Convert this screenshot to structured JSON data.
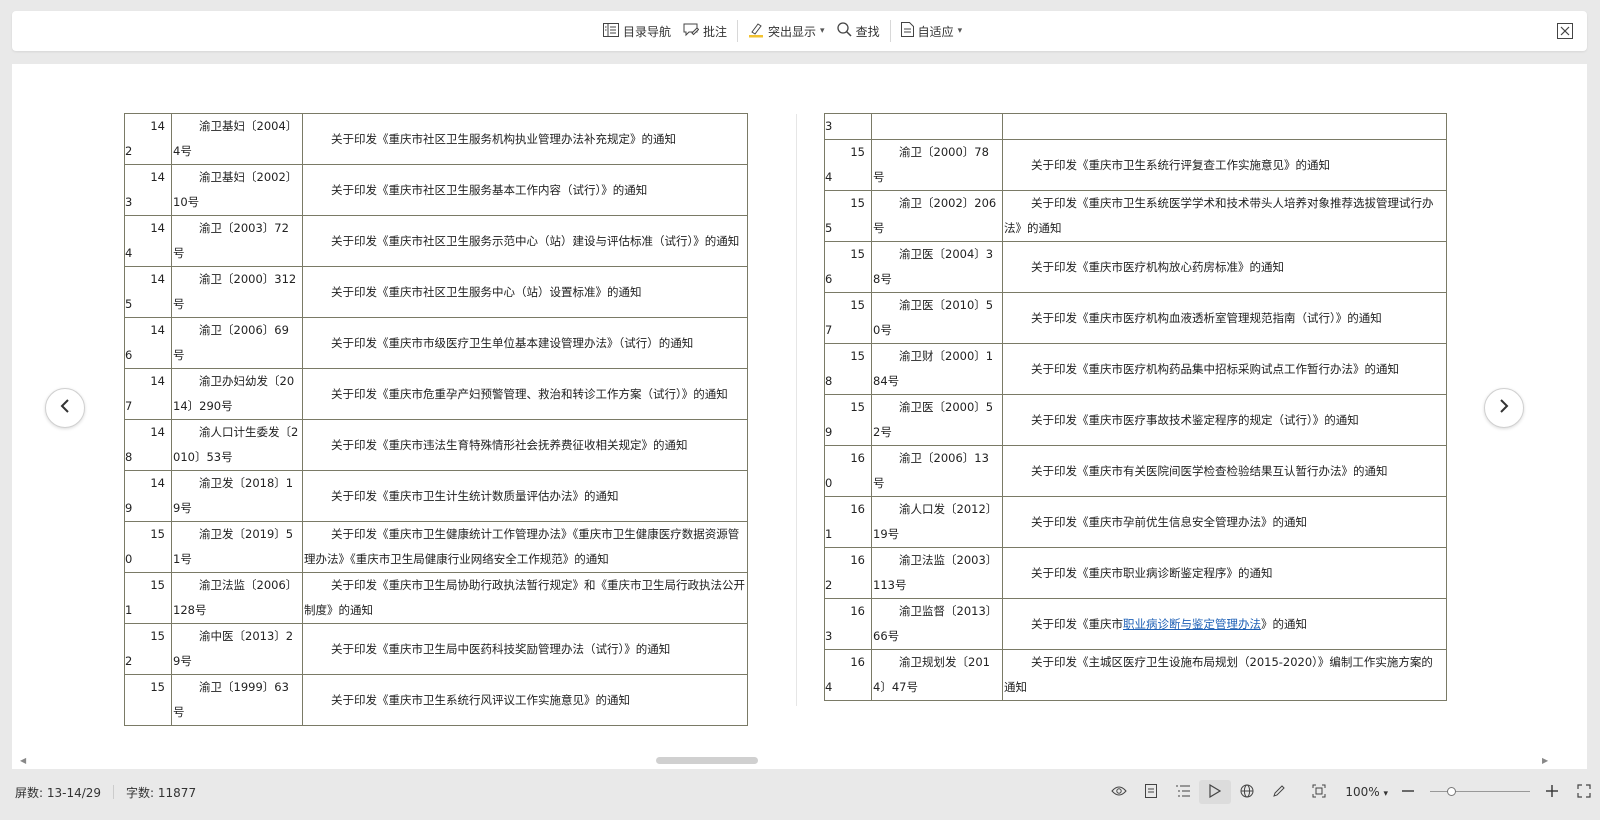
{
  "toolbar": {
    "toc_label": "目录导航",
    "annotate_label": "批注",
    "highlight_label": "突出显示",
    "find_label": "查找",
    "fit_label": "自适应"
  },
  "left_rows": [
    {
      "n1": "14",
      "n2": "2",
      "code": "渝卫基妇〔2004〕4号",
      "title": "关于印发《重庆市社区卫生服务机构执业管理办法补充规定》的通知"
    },
    {
      "n1": "14",
      "n2": "3",
      "code": "渝卫基妇〔2002〕10号",
      "title": "关于印发《重庆市社区卫生服务基本工作内容（试行）》的通知"
    },
    {
      "n1": "14",
      "n2": "4",
      "code": "渝卫〔2003〕72号",
      "title": "关于印发《重庆市社区卫生服务示范中心（站）建设与评估标准（试行）》的通知"
    },
    {
      "n1": "14",
      "n2": "5",
      "code": "渝卫〔2000〕312号",
      "title": "关于印发《重庆市社区卫生服务中心（站）设置标准》的通知"
    },
    {
      "n1": "14",
      "n2": "6",
      "code": "渝卫〔2006〕69号",
      "title": "关于印发《重庆市市级医疗卫生单位基本建设管理办法》（试行）的通知"
    },
    {
      "n1": "14",
      "n2": "7",
      "code": "渝卫办妇幼发〔2014〕290号",
      "title": "关于印发《重庆市危重孕产妇预警管理、救治和转诊工作方案（试行）》的通知"
    },
    {
      "n1": "14",
      "n2": "8",
      "code": "渝人口计生委发〔2010〕53号",
      "title": "关于印发《重庆市违法生育特殊情形社会抚养费征收相关规定》的通知"
    },
    {
      "n1": "14",
      "n2": "9",
      "code": "渝卫发〔2018〕19号",
      "title": "关于印发《重庆市卫生计生统计数质量评估办法》的通知"
    },
    {
      "n1": "15",
      "n2": "0",
      "code": "渝卫发〔2019〕51号",
      "title": "关于印发《重庆市卫生健康统计工作管理办法》《重庆市卫生健康医疗数据资源管理办法》《重庆市卫生局健康行业网络安全工作规范》的通知"
    },
    {
      "n1": "15",
      "n2": "1",
      "code": "渝卫法监〔2006〕128号",
      "title": "关于印发《重庆市卫生局协助行政执法暂行规定》和《重庆市卫生局行政执法公开制度》的通知"
    },
    {
      "n1": "15",
      "n2": "2",
      "code": "渝中医〔2013〕29号",
      "title": "关于印发《重庆市卫生局中医药科技奖励管理办法（试行）》的通知"
    },
    {
      "n1": "15",
      "n2": "",
      "code": "渝卫〔1999〕63号",
      "title": "关于印发《重庆市卫生系统行风评议工作实施意见》的通知"
    }
  ],
  "right_top_row": {
    "n1": "3"
  },
  "right_rows": [
    {
      "n1": "15",
      "n2": "4",
      "code": "渝卫〔2000〕78号",
      "title": "关于印发《重庆市卫生系统行评复查工作实施意见》的通知"
    },
    {
      "n1": "15",
      "n2": "5",
      "code": "渝卫〔2002〕206号",
      "title": "关于印发《重庆市卫生系统医学学术和技术带头人培养对象推荐选拔管理试行办法》的通知"
    },
    {
      "n1": "15",
      "n2": "6",
      "code": "渝卫医〔2004〕38号",
      "title": "关于印发《重庆市医疗机构放心药房标准》的通知"
    },
    {
      "n1": "15",
      "n2": "7",
      "code": "渝卫医〔2010〕50号",
      "title": "关于印发《重庆市医疗机构血液透析室管理规范指南（试行）》的通知"
    },
    {
      "n1": "15",
      "n2": "8",
      "code": "渝卫财〔2000〕184号",
      "title": "关于印发《重庆市医疗机构药品集中招标采购试点工作暂行办法》的通知"
    },
    {
      "n1": "15",
      "n2": "9",
      "code": "渝卫医〔2000〕52号",
      "title": "关于印发《重庆市医疗事故技术鉴定程序的规定（试行）》的通知"
    },
    {
      "n1": "16",
      "n2": "0",
      "code": "渝卫〔2006〕13号",
      "title": "关于印发《重庆市有关医院间医学检查检验结果互认暂行办法》的通知"
    },
    {
      "n1": "16",
      "n2": "1",
      "code": "渝人口发〔2012〕19号",
      "title": "关于印发《重庆市孕前优生信息安全管理办法》的通知"
    },
    {
      "n1": "16",
      "n2": "2",
      "code": "渝卫法监〔2003〕113号",
      "title": "关于印发《重庆市职业病诊断鉴定程序》的通知"
    },
    {
      "n1": "16",
      "n2": "3",
      "code": "渝卫监督〔2013〕66号",
      "title_pre": "关于印发《重庆市",
      "title_link": "职业病诊断与鉴定管理办法",
      "title_post": "》的通知"
    },
    {
      "n1": "16",
      "n2": "4",
      "code": "渝卫规划发〔2014〕47号",
      "title": "关于印发《主城区医疗卫生设施布局规划（2015-2020）》编制工作实施方案的通知"
    }
  ],
  "status": {
    "screen_label": "屏数: 13-14/29",
    "word_count_label": "字数: 11877",
    "zoom_label": "100%",
    "zoom_level": 1.0
  }
}
